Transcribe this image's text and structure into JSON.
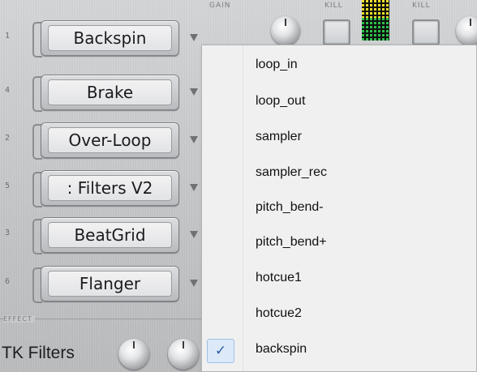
{
  "header": {
    "gain_label": "GAIN",
    "kill_left_label": "KILL",
    "kill_right_label": "KILL"
  },
  "slots": [
    {
      "number": "1",
      "label": "Backspin"
    },
    {
      "number": "4",
      "label": "Brake"
    },
    {
      "number": "2",
      "label": "Over-Loop"
    },
    {
      "number": "5",
      "label": ": Filters V2"
    },
    {
      "number": "3",
      "label": "BeatGrid"
    },
    {
      "number": "6",
      "label": "Flanger"
    }
  ],
  "footer": {
    "effect_label": "EFFECT",
    "tk_filters_label": "TK Filters"
  },
  "menu": {
    "items": [
      {
        "label": "loop_in",
        "checked": false
      },
      {
        "label": "loop_out",
        "checked": false
      },
      {
        "label": "sampler",
        "checked": false
      },
      {
        "label": "sampler_rec",
        "checked": false
      },
      {
        "label": "pitch_bend-",
        "checked": false
      },
      {
        "label": "pitch_bend+",
        "checked": false
      },
      {
        "label": "hotcue1",
        "checked": false
      },
      {
        "label": "hotcue2",
        "checked": false
      },
      {
        "label": "backspin",
        "checked": true
      }
    ],
    "check_glyph": "✓"
  },
  "icons": {
    "dropdown_arrow": "triangle-down-icon",
    "knob": "rotary-knob-icon",
    "check": "checkmark-icon"
  },
  "colors": {
    "menu_background": "#f0f0f0",
    "check_highlight": "#dce9f8",
    "check_color": "#2f5da6",
    "vu_green": "#2fbf4a",
    "vu_yellow": "#f1dd2a"
  }
}
